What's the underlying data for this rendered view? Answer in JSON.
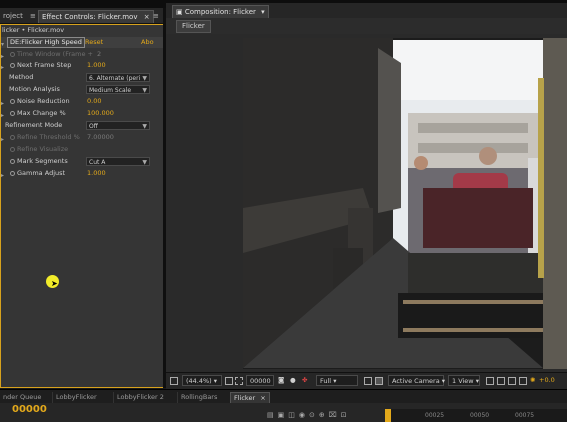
{
  "left_tabs": {
    "project": "roject",
    "effect_controls": "Effect Controls: Flicker.mov"
  },
  "breadcrumb": "licker • Flicker.mov",
  "effect": {
    "name": "DE:Flicker High Speed",
    "reset": "Reset",
    "about": "Abo"
  },
  "params": [
    {
      "label": "Time Window (Frame +",
      "value": "2",
      "dim": true
    },
    {
      "label": "Next Frame Step",
      "value": "1.000"
    },
    {
      "label": "Method",
      "dropdown": "6. Alternate (peri"
    },
    {
      "label": "Motion Analysis",
      "dropdown": "Medium  Scale"
    },
    {
      "label": "Noise Reduction",
      "value": "0.00"
    },
    {
      "label": "Max Change %",
      "value": "100.000"
    },
    {
      "label": "Refinement Mode",
      "dropdown": "Off"
    },
    {
      "label": "Refine Threshold %",
      "value": "7.00000",
      "dim": true
    },
    {
      "label": "Refine Visualize",
      "value": "",
      "dim": true
    },
    {
      "label": "Mark Segments",
      "dropdown": "Cut A"
    },
    {
      "label": "Gamma Adjust",
      "value": "1.000"
    }
  ],
  "composition": {
    "tab": "Composition: Flicker",
    "chip": "Flicker"
  },
  "viewer_bar": {
    "zoom": "(44.4%)",
    "timecode": "00000",
    "resolution": "Full",
    "camera": "Active Camera",
    "view": "1 View",
    "exposure": "+0.0"
  },
  "timeline_tabs": [
    "nder Queue",
    "LobbyFlicker",
    "LobbyFlicker 2",
    "RollingBars",
    "Flicker"
  ],
  "timeline": {
    "timecode": "00000",
    "ruler": [
      "00025",
      "00050",
      "00075"
    ]
  },
  "colors": {
    "accent": "#e3a91b",
    "panel_border": "#d7a21d"
  }
}
